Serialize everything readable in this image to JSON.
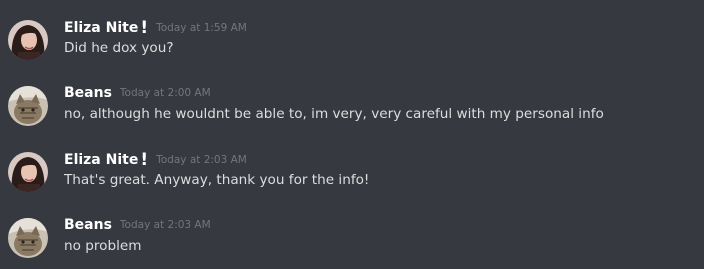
{
  "messages": [
    {
      "author": "Eliza Nite",
      "badge": "!",
      "timestamp": "Today at 1:59 AM",
      "text": "Did he dox you?",
      "avatar_icon": "eliza-avatar"
    },
    {
      "author": "Beans",
      "badge": "",
      "timestamp": "Today at 2:00 AM",
      "text": "no, although he wouldnt be able to, im very, very careful with my personal info",
      "avatar_icon": "cat-avatar"
    },
    {
      "author": "Eliza Nite",
      "badge": "!",
      "timestamp": "Today at 2:03 AM",
      "text": "That's great. Anyway, thank you for the info!",
      "avatar_icon": "eliza-avatar"
    },
    {
      "author": "Beans",
      "badge": "",
      "timestamp": "Today at 2:03 AM",
      "text": "no problem",
      "avatar_icon": "cat-avatar"
    }
  ],
  "colors": {
    "background": "#36393f",
    "username": "#ffffff",
    "timestamp": "#72767d",
    "message_text": "#dcddde"
  }
}
